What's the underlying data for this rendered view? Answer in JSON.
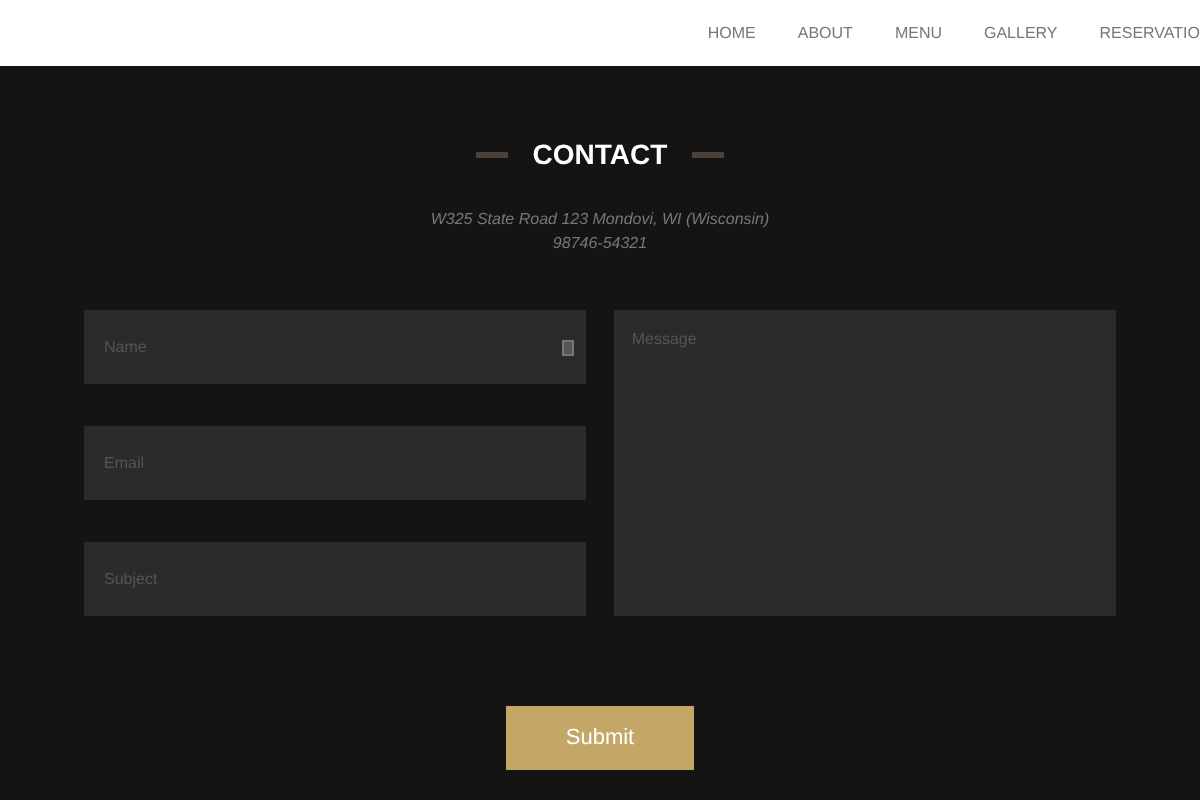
{
  "nav": {
    "items": [
      {
        "label": "HOME"
      },
      {
        "label": "ABOUT"
      },
      {
        "label": "MENU"
      },
      {
        "label": "GALLERY"
      },
      {
        "label": "RESERVATIO"
      }
    ]
  },
  "contact": {
    "title": "CONTACT",
    "address": "W325 State Road 123 Mondovi, WI (Wisconsin)",
    "phone": "98746-54321",
    "fields": [
      {
        "placeholder": "Name"
      },
      {
        "placeholder": "Email"
      },
      {
        "placeholder": "Subject"
      }
    ],
    "message": {
      "placeholder": "Message"
    },
    "submit": "Submit"
  }
}
